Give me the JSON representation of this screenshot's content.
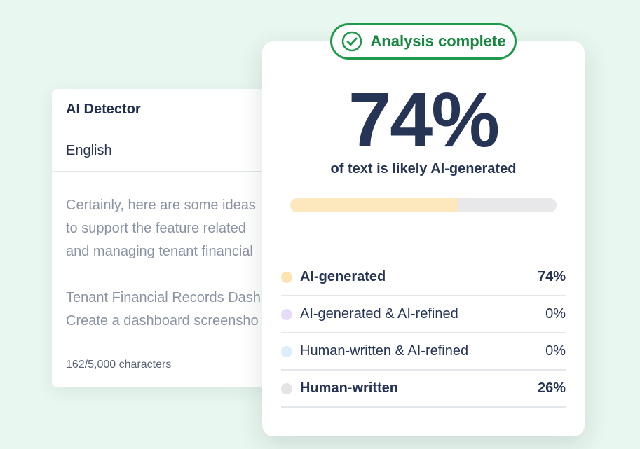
{
  "detector": {
    "title": "AI Detector",
    "language": "English",
    "text_lines_1": [
      "Certainly, here are some ideas",
      "to support the feature related",
      "and managing tenant financial"
    ],
    "text_lines_2": [
      "Tenant Financial Records Dash",
      "Create a dashboard screensho"
    ],
    "char_count": "162/5,000 characters"
  },
  "result": {
    "badge_label": "Analysis complete",
    "percent": "74%",
    "subtitle": "of text is likely AI-generated",
    "progress_fraction": 0.63,
    "colors": {
      "accent_green": "#1f9a4d",
      "progress_fill": "#fde7bd",
      "progress_track": "#e8e8ea"
    },
    "breakdown": [
      {
        "label": "AI-generated",
        "value": "74%",
        "bold": true,
        "color": "#fde3b2"
      },
      {
        "label": "AI-generated & AI-refined",
        "value": "0%",
        "bold": false,
        "color": "#e6dcf8"
      },
      {
        "label": "Human-written & AI-refined",
        "value": "0%",
        "bold": false,
        "color": "#dcedfb"
      },
      {
        "label": "Human-written",
        "value": "26%",
        "bold": true,
        "color": "#e4e4e6"
      }
    ]
  }
}
